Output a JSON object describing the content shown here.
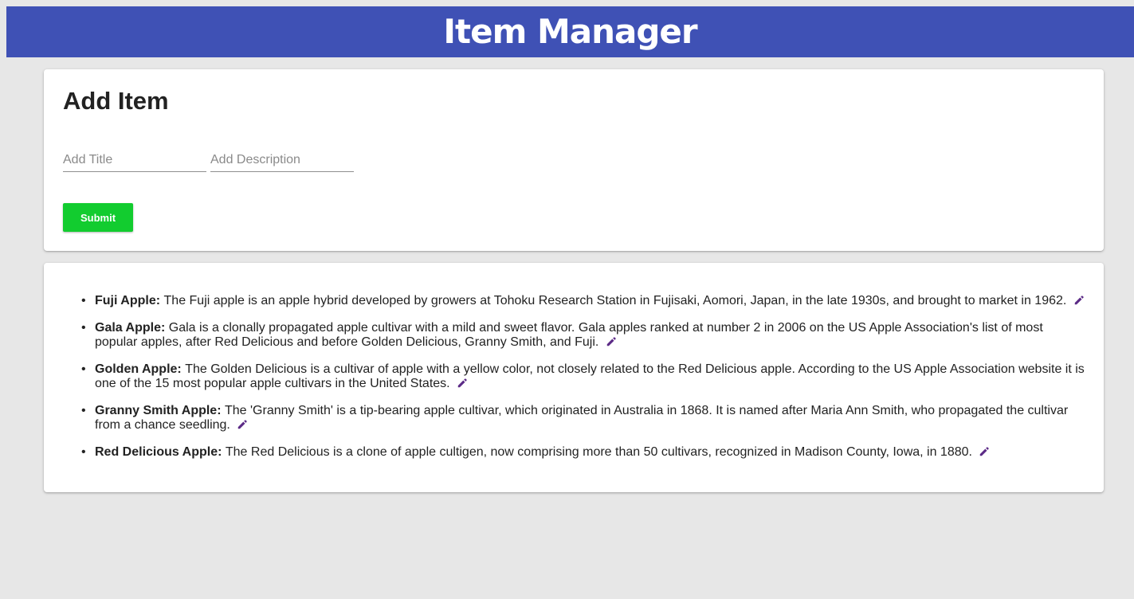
{
  "header": {
    "title": "Item Manager"
  },
  "add_form": {
    "heading": "Add Item",
    "title_placeholder": "Add Title",
    "description_placeholder": "Add Description",
    "title_value": "",
    "description_value": "",
    "submit_label": "Submit"
  },
  "items": [
    {
      "title": "Fuji Apple:",
      "description": "The Fuji apple is an apple hybrid developed by growers at Tohoku Research Station in Fujisaki, Aomori, Japan, in the late 1930s, and brought to market in 1962."
    },
    {
      "title": "Gala Apple:",
      "description": "Gala is a clonally propagated apple cultivar with a mild and sweet flavor. Gala apples ranked at number 2 in 2006 on the US Apple Association's list of most popular apples, after Red Delicious and before Golden Delicious, Granny Smith, and Fuji."
    },
    {
      "title": "Golden Apple:",
      "description": "The Golden Delicious is a cultivar of apple with a yellow color, not closely related to the Red Delicious apple. According to the US Apple Association website it is one of the 15 most popular apple cultivars in the United States."
    },
    {
      "title": "Granny Smith Apple:",
      "description": "The 'Granny Smith' is a tip-bearing apple cultivar, which originated in Australia in 1868. It is named after Maria Ann Smith, who propagated the cultivar from a chance seedling."
    },
    {
      "title": "Red Delicious Apple:",
      "description": "The Red Delicious is a clone of apple cultigen, now comprising more than 50 cultivars, recognized in Madison County, Iowa, in 1880."
    }
  ],
  "icons": {
    "edit": "pencil-icon"
  },
  "colors": {
    "header_bg": "#3f51b5",
    "submit_bg": "#12cc2f",
    "edit_icon": "#5b2a86",
    "page_bg": "#e7e7e7"
  }
}
